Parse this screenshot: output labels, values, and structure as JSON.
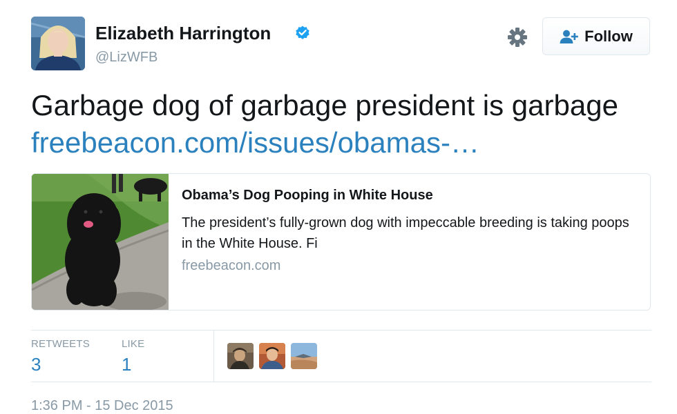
{
  "author": {
    "display_name": "Elizabeth Harrington",
    "handle": "@LizWFB",
    "verified": true,
    "avatar_icon": "profile-photo"
  },
  "actions": {
    "settings_icon": "gear-icon",
    "follow_label": "Follow",
    "follow_icon": "add-user-icon"
  },
  "tweet": {
    "text": "Garbage dog of garbage president is garbage ",
    "link_text": "freebeacon.com/issues/obamas-…"
  },
  "card": {
    "title": "Obama’s Dog Pooping in White House",
    "description": "The president’s fully-grown dog with impeccable breeding is taking poops in the White House. Fi",
    "domain": "freebeacon.com",
    "image_icon": "black-dog-on-lawn-photo"
  },
  "stats": {
    "retweets_label": "RETWEETS",
    "retweets_value": "3",
    "likes_label": "LIKE",
    "likes_value": "1"
  },
  "likers": [
    {
      "name": "liker-avatar-1"
    },
    {
      "name": "liker-avatar-2"
    },
    {
      "name": "liker-avatar-3"
    }
  ],
  "timestamp": "1:36 PM - 15 Dec 2015",
  "colors": {
    "link": "#2a81bd",
    "muted": "#8899a6",
    "verified": "#1da1f2",
    "border": "#e1e8ed"
  }
}
